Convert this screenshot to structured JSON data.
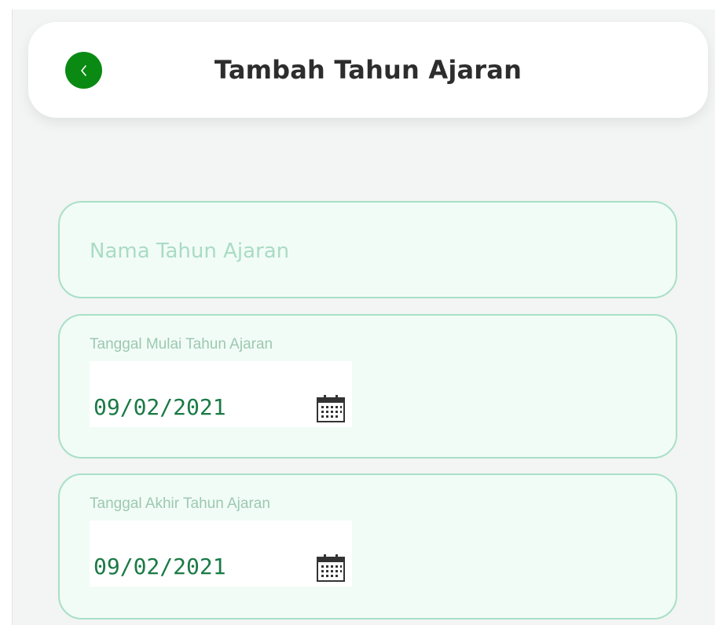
{
  "header": {
    "title": "Tambah Tahun Ajaran",
    "back_icon": "chevron-left-icon",
    "back_button_color": "#0a8a13"
  },
  "form": {
    "name_field": {
      "placeholder": "Nama Tahun Ajaran",
      "value": ""
    },
    "start_date": {
      "label": "Tanggal Mulai Tahun Ajaran",
      "value": "09/02/2021",
      "icon": "calendar-icon"
    },
    "end_date": {
      "label": "Tanggal Akhir Tahun Ajaran",
      "value": "09/02/2021",
      "icon": "calendar-icon"
    }
  },
  "colors": {
    "page_background": "#f3f4f4",
    "field_background": "#f2fcf7",
    "field_border": "#a8e0c6",
    "date_text": "#1a7a45",
    "label_text": "#9cc8b1",
    "placeholder_text": "#a9dcc4"
  }
}
